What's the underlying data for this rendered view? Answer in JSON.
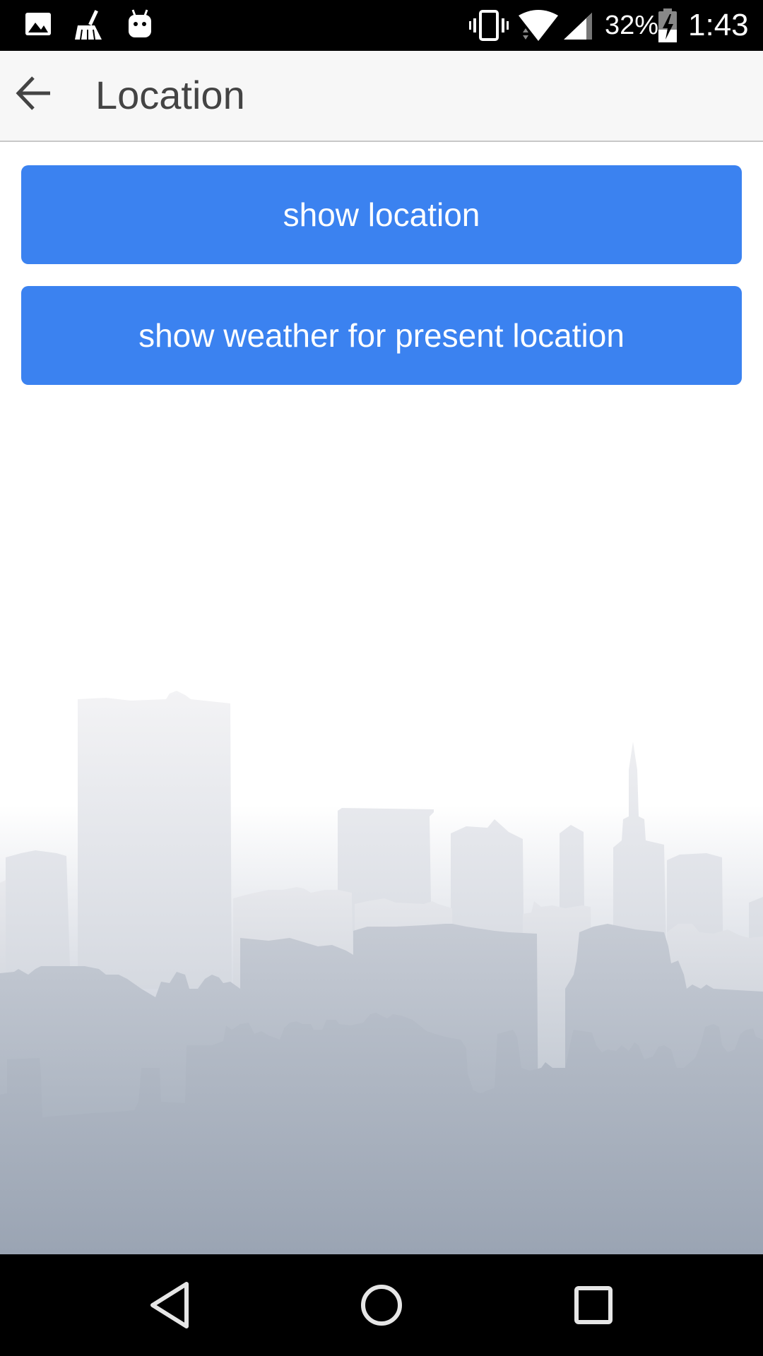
{
  "status_bar": {
    "battery_percent": "32%",
    "clock": "1:43",
    "icons": [
      "image-icon",
      "broom-icon",
      "android-icon",
      "vibrate-icon",
      "wifi-icon",
      "cell-signal-icon",
      "battery-charging-icon"
    ]
  },
  "app_bar": {
    "title": "Location",
    "back_icon": "arrow-back-icon"
  },
  "buttons": {
    "show_location": "show location",
    "show_weather": "show weather for present location"
  },
  "colors": {
    "button_blue": "#3b82f0",
    "app_bar_bg": "#f7f7f7",
    "title_text": "#444444"
  },
  "nav_bar": {
    "icons": [
      "back-triangle-icon",
      "home-circle-icon",
      "recents-square-icon"
    ]
  }
}
